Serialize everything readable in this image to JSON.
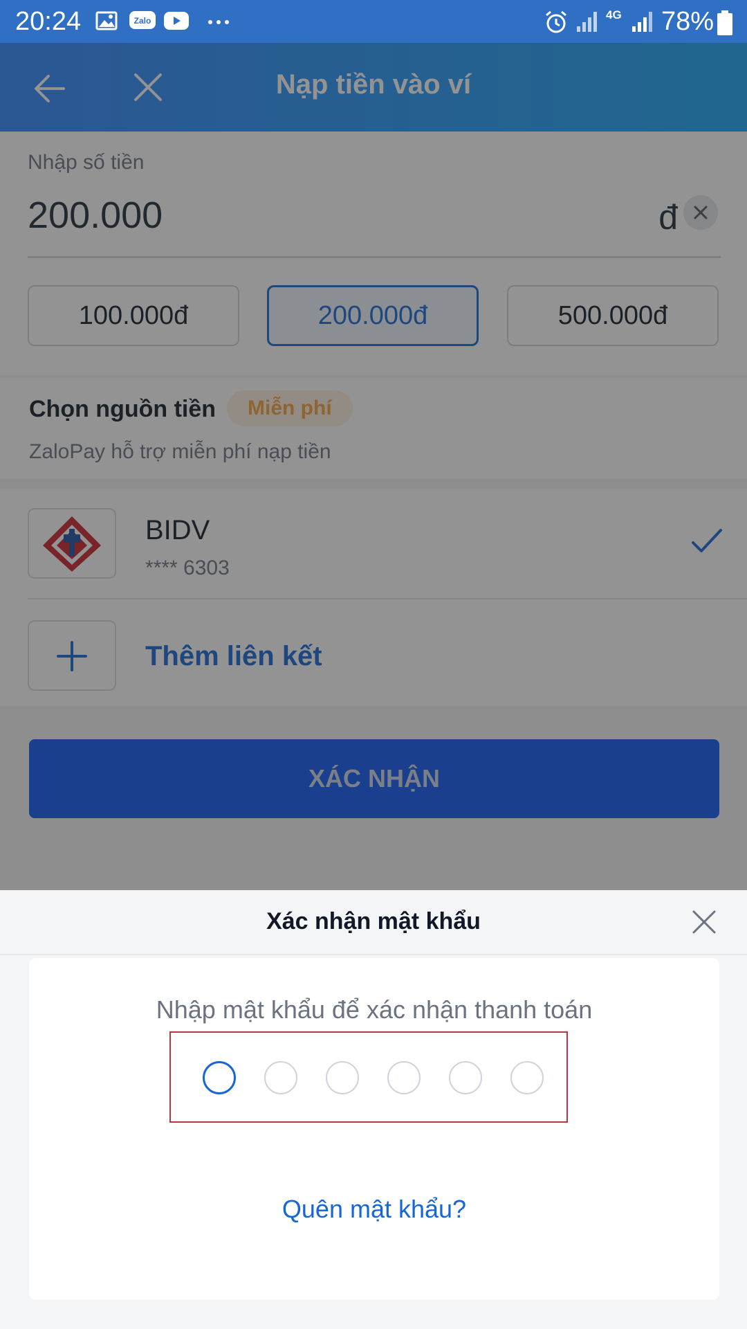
{
  "status_bar": {
    "time": "20:24",
    "battery": "78%",
    "network": "4G",
    "icons": [
      "gallery-icon",
      "zalo-icon",
      "youtube-icon",
      "more-icon",
      "alarm-icon",
      "signal-icon",
      "battery-icon"
    ]
  },
  "app_bar": {
    "title": "Nạp tiền vào ví",
    "back_icon": "arrow-left-icon",
    "close_icon": "close-icon"
  },
  "amount": {
    "label": "Nhập số tiền",
    "value": "200.000",
    "currency": "đ",
    "quick_options": [
      {
        "label": "100.000đ",
        "selected": false
      },
      {
        "label": "200.000đ",
        "selected": true
      },
      {
        "label": "500.000đ",
        "selected": false
      }
    ]
  },
  "source": {
    "title": "Chọn nguồn tiền",
    "badge": "Miễn phí",
    "description": "ZaloPay hỗ trợ miễn phí nạp tiền",
    "bank": {
      "name": "BIDV",
      "account": "**** 6303",
      "selected": true
    },
    "add_link_label": "Thêm liên kết"
  },
  "confirm_button": "XÁC NHẬN",
  "password_sheet": {
    "title": "Xác nhận mật khẩu",
    "description": "Nhập mật khẩu để xác nhận thanh toán",
    "pin_length": 6,
    "forgot_label": "Quên mật khẩu?"
  },
  "colors": {
    "primary": "#1766d6",
    "app_bar_start": "#2f86ff",
    "app_bar_end": "#19a6f5",
    "badge_text": "#f2a33a",
    "pin_outline": "#b8363f"
  }
}
